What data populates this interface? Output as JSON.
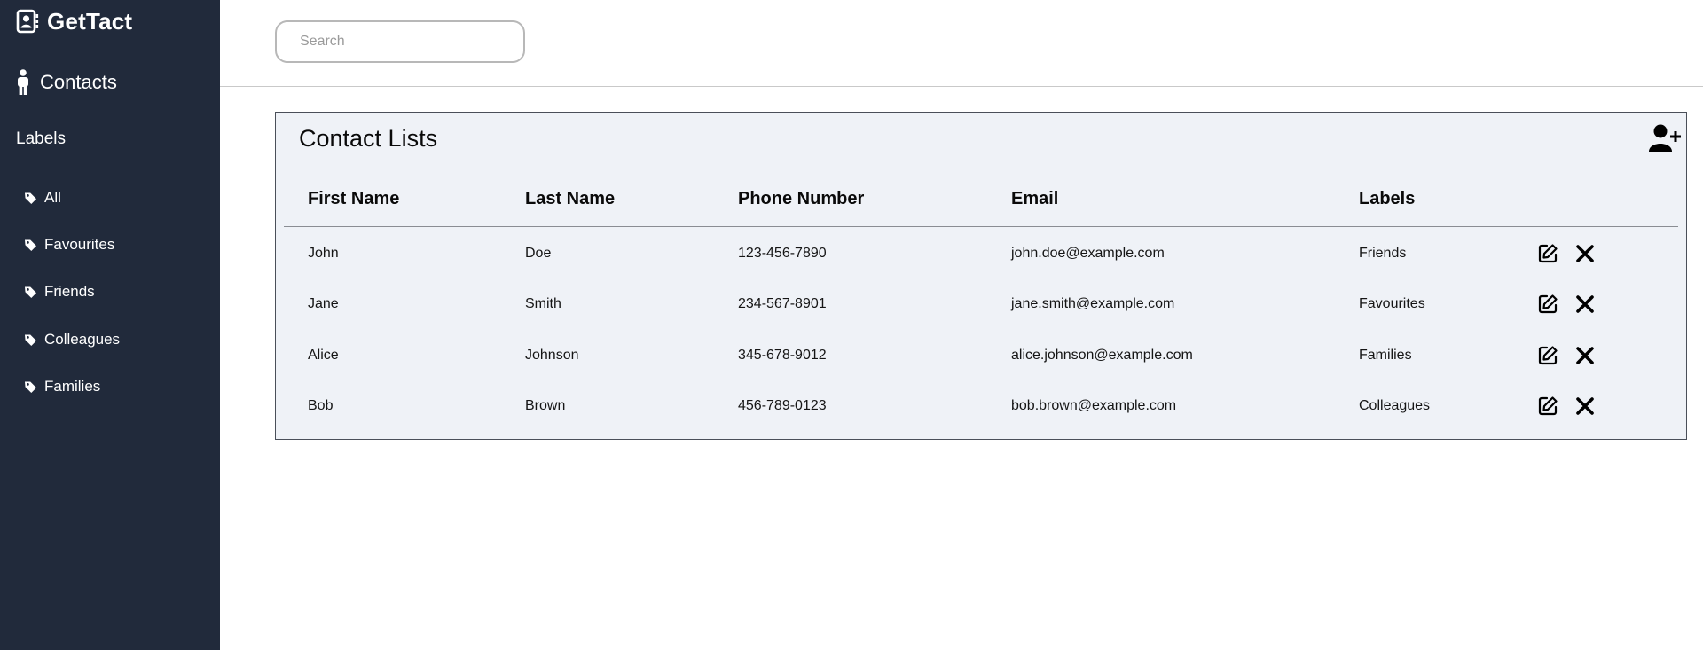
{
  "app": {
    "brand_name": "GetTact",
    "brand_icon": "address-book-icon"
  },
  "sidebar": {
    "contacts_label": "Contacts",
    "contacts_icon": "person-icon",
    "labels_heading": "Labels",
    "label_icon": "tag-icon",
    "label_items": [
      {
        "label": "All"
      },
      {
        "label": "Favourites"
      },
      {
        "label": "Friends"
      },
      {
        "label": "Colleagues"
      },
      {
        "label": "Families"
      }
    ]
  },
  "search": {
    "placeholder": "Search",
    "value": ""
  },
  "contacts_panel": {
    "title": "Contact Lists",
    "add_icon": "add-user-icon",
    "columns": [
      "First Name",
      "Last Name",
      "Phone Number",
      "Email",
      "Labels"
    ],
    "rows": [
      {
        "first_name": "John",
        "last_name": "Doe",
        "phone": "123-456-7890",
        "email": "john.doe@example.com",
        "label": "Friends"
      },
      {
        "first_name": "Jane",
        "last_name": "Smith",
        "phone": "234-567-8901",
        "email": "jane.smith@example.com",
        "label": "Favourites"
      },
      {
        "first_name": "Alice",
        "last_name": "Johnson",
        "phone": "345-678-9012",
        "email": "alice.johnson@example.com",
        "label": "Families"
      },
      {
        "first_name": "Bob",
        "last_name": "Brown",
        "phone": "456-789-0123",
        "email": "bob.brown@example.com",
        "label": "Colleagues"
      }
    ],
    "row_action_icons": [
      "edit-icon",
      "close-icon"
    ]
  },
  "colors": {
    "sidebar_bg": "#212a3b",
    "panel_bg": "#eff2f7",
    "text": "#0a0a0a"
  }
}
